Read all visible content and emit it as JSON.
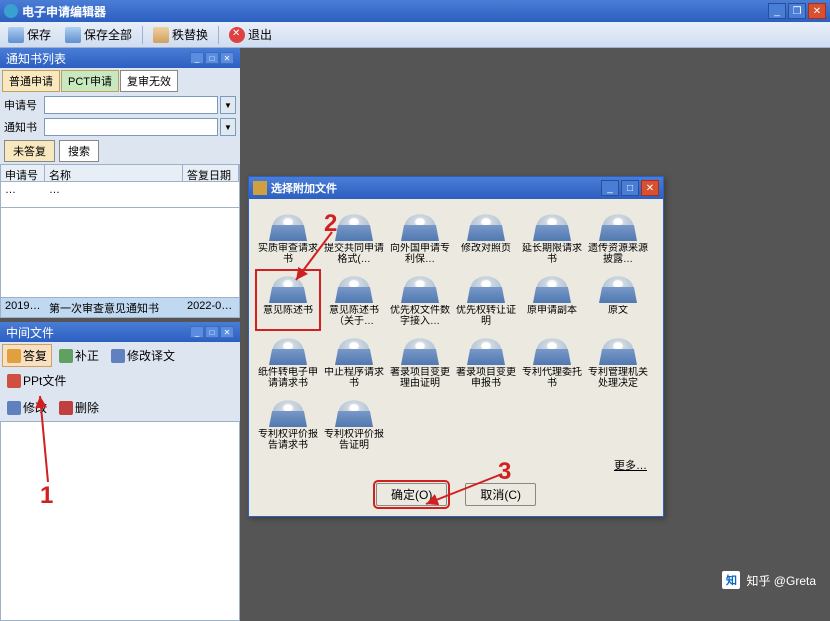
{
  "app": {
    "title": "电子申请编辑器"
  },
  "toolbar": {
    "save": "保存",
    "save_all": "保存全部",
    "swap": "秩替换",
    "exit": "退出"
  },
  "upper_panel": {
    "title": "通知书列表",
    "tabs": [
      "普通申请",
      "PCT申请",
      "复审无效"
    ],
    "field1_label": "申请号",
    "field2_label": "通知书",
    "search_tabs": [
      "未答复",
      "搜索"
    ],
    "cols": {
      "c1": "申请号",
      "c2": "名称",
      "c3": "答复日期"
    },
    "rows": [
      {
        "c1": "2019…",
        "c2": "第一次审查意见通知书",
        "c3": "2022-0…"
      }
    ]
  },
  "lower_panel": {
    "title": "中间文件",
    "btns": {
      "reply": "答复",
      "fix": "补正",
      "edit": "修改译文",
      "ppt": "PPt文件",
      "mod": "修改",
      "del": "删除"
    }
  },
  "dialog": {
    "title": "选择附加文件",
    "files": [
      "实质审查请求书",
      "提交共同申请格式(…",
      "向外国申请专利保…",
      "修改对照页",
      "延长期限请求书",
      "遗传资源来源披露…",
      "意见陈述书",
      "意见陈述书（关于…",
      "优先权文件数字接入…",
      "优先权转让证明",
      "原申请副本",
      "原文",
      "纸件转电子申请请求书",
      "中止程序请求书",
      "著录项目变更理由证明",
      "著录项目变更申报书",
      "专利代理委托书",
      "专利管理机关处理决定",
      "专利权评价报告请求书",
      "专利权评价报告证明"
    ],
    "selected_index": 6,
    "more": "更多…",
    "ok": "确定(O)",
    "cancel": "取消(C)"
  },
  "annotations": {
    "a1": "1",
    "a2": "2",
    "a3": "3"
  },
  "watermark": {
    "logo": "知",
    "text": "知乎 @Greta"
  }
}
